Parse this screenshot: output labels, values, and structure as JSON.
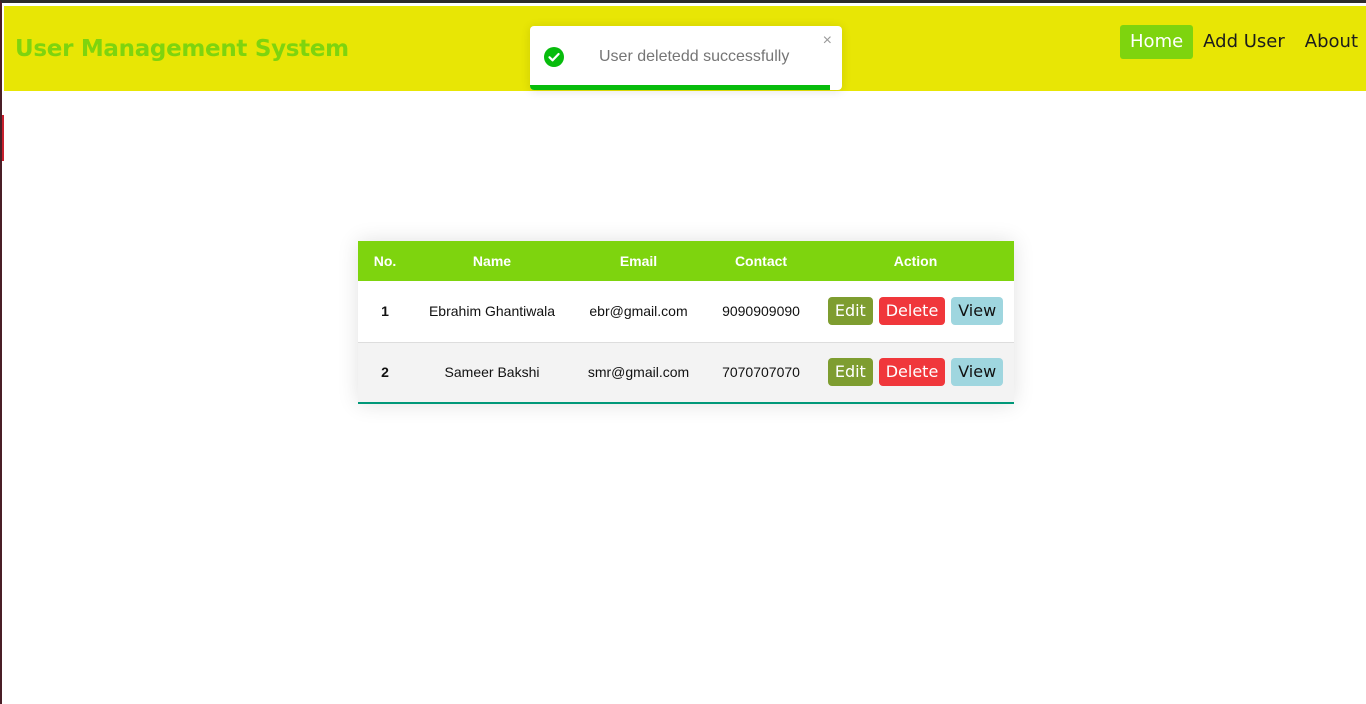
{
  "header": {
    "title": "User Management System",
    "nav": [
      {
        "label": "Home",
        "active": true
      },
      {
        "label": "Add User",
        "active": false
      },
      {
        "label": "About",
        "active": false
      }
    ]
  },
  "toast": {
    "message": "User deletedd successfully",
    "close_label": "×",
    "icon": "check-circle-icon",
    "progress": 0.96
  },
  "table": {
    "columns": [
      "No.",
      "Name",
      "Email",
      "Contact",
      "Action"
    ],
    "rows": [
      {
        "no": "1",
        "name": "Ebrahim Ghantiwala",
        "email": "ebr@gmail.com",
        "contact": "9090909090"
      },
      {
        "no": "2",
        "name": "Sameer Bakshi",
        "email": "smr@gmail.com",
        "contact": "7070707070"
      }
    ],
    "actions": {
      "edit": "Edit",
      "delete": "Delete",
      "view": "View"
    }
  },
  "colors": {
    "header_bg": "#e8e605",
    "accent": "#7ed40e",
    "edit": "#7e9d30",
    "delete": "#f0373b",
    "view": "#9fd6df",
    "toast_success": "#07bc0c"
  }
}
